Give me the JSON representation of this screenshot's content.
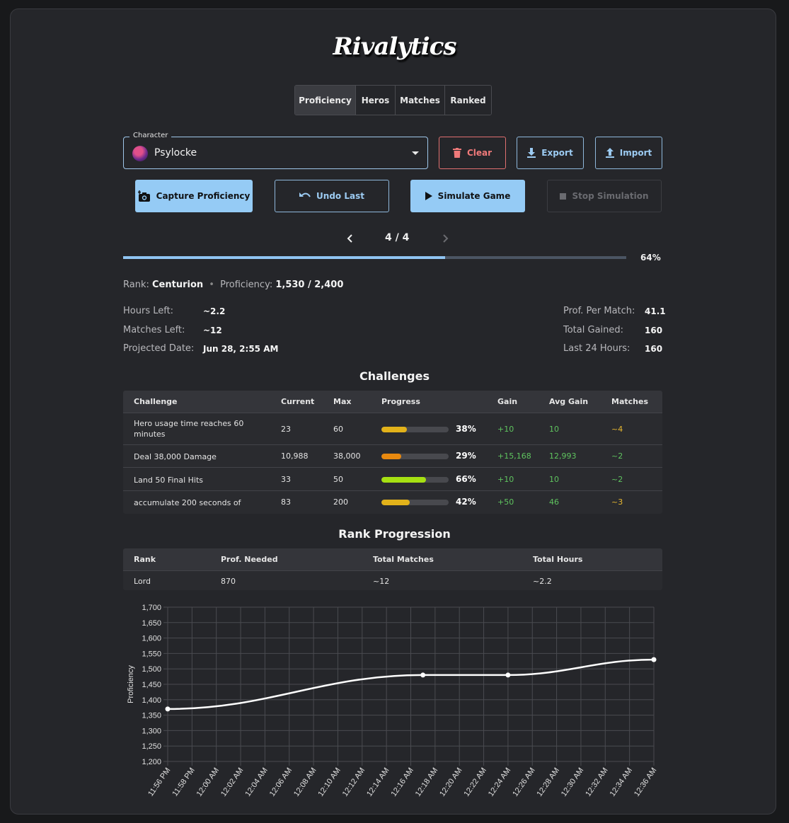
{
  "app": {
    "logo": "Rivalytics"
  },
  "tabs": [
    {
      "label": "Proficiency",
      "active": true
    },
    {
      "label": "Heros",
      "active": false
    },
    {
      "label": "Matches",
      "active": false
    },
    {
      "label": "Ranked",
      "active": false
    }
  ],
  "character": {
    "legend": "Character",
    "value": "Psylocke"
  },
  "buttons": {
    "clear": "Clear",
    "export": "Export",
    "import": "Import",
    "capture": "Capture Proficiency",
    "undo": "Undo Last",
    "simulate": "Simulate Game",
    "stop": "Stop Simulation"
  },
  "pager": {
    "text": "4 / 4"
  },
  "progress": {
    "value": 0.64,
    "label": "64%"
  },
  "summary": {
    "rank_label": "Rank:",
    "rank_value": "Centurion",
    "separator": "•",
    "prof_label": "Proficiency:",
    "prof_value": "1,530 / 2,400"
  },
  "stats_left": [
    {
      "label": "Hours Left:",
      "value": "~2.2"
    },
    {
      "label": "Matches Left:",
      "value": "~12"
    },
    {
      "label": "Projected Date:",
      "value": "Jun 28, 2:55 AM"
    }
  ],
  "stats_right": [
    {
      "label": "Prof. Per Match:",
      "value": "41.1"
    },
    {
      "label": "Total Gained:",
      "value": "160"
    },
    {
      "label": "Last 24 Hours:",
      "value": "160"
    }
  ],
  "challenges": {
    "title": "Challenges",
    "headers": [
      "Challenge",
      "Current",
      "Max",
      "Progress",
      "Gain",
      "Avg Gain",
      "Matches"
    ],
    "rows": [
      {
        "name": "Hero usage time reaches 60 minutes",
        "current": "23",
        "max": "60",
        "progress": 0.38,
        "pct": "38%",
        "bar_color": "#e2b21a",
        "gain": "+10",
        "avg": "10",
        "matches": "~4",
        "matches_color": "#e8b830"
      },
      {
        "name": "Deal 38,000 Damage",
        "current": "10,988",
        "max": "38,000",
        "progress": 0.29,
        "pct": "29%",
        "bar_color": "#e8890f",
        "gain": "+15,168",
        "avg": "12,993",
        "matches": "~2",
        "matches_color": "#5fc45f"
      },
      {
        "name": "Land 50 Final Hits",
        "current": "33",
        "max": "50",
        "progress": 0.66,
        "pct": "66%",
        "bar_color": "#a6e012",
        "gain": "+10",
        "avg": "10",
        "matches": "~2",
        "matches_color": "#5fc45f"
      },
      {
        "name": "accumulate 200 seconds of",
        "current": "83",
        "max": "200",
        "progress": 0.42,
        "pct": "42%",
        "bar_color": "#e2b21a",
        "gain": "+50",
        "avg": "46",
        "matches": "~3",
        "matches_color": "#e8b830"
      }
    ]
  },
  "rank_progression": {
    "title": "Rank Progression",
    "headers": [
      "Rank",
      "Prof. Needed",
      "Total Matches",
      "Total Hours"
    ],
    "rows": [
      {
        "rank": "Lord",
        "needed": "870",
        "matches": "~12",
        "hours": "~2.2"
      }
    ]
  },
  "chart_data": {
    "type": "line",
    "ylabel": "Proficiency",
    "xlabel": "",
    "ylim": [
      1200,
      1700
    ],
    "yticks": [
      "1,700",
      "1,650",
      "1,600",
      "1,550",
      "1,500",
      "1,450",
      "1,400",
      "1,350",
      "1,300",
      "1,250",
      "1,200"
    ],
    "categories": [
      "11:56 PM",
      "11:58 PM",
      "12:00 AM",
      "12:02 AM",
      "12:04 AM",
      "12:06 AM",
      "12:08 AM",
      "12:10 AM",
      "12:12 AM",
      "12:14 AM",
      "12:16 AM",
      "12:18 AM",
      "12:20 AM",
      "12:22 AM",
      "12:24 AM",
      "12:26 AM",
      "12:28 AM",
      "12:30 AM",
      "12:32 AM",
      "12:34 AM",
      "12:36 AM"
    ],
    "series": [
      {
        "points": [
          {
            "x": "11:56 PM",
            "y": 1370
          },
          {
            "x": "12:17 AM",
            "y": 1480
          },
          {
            "x": "12:24 AM",
            "y": 1480
          },
          {
            "x": "12:36 AM",
            "y": 1530
          }
        ]
      }
    ],
    "grid": true,
    "line_color": "#ffffff"
  }
}
